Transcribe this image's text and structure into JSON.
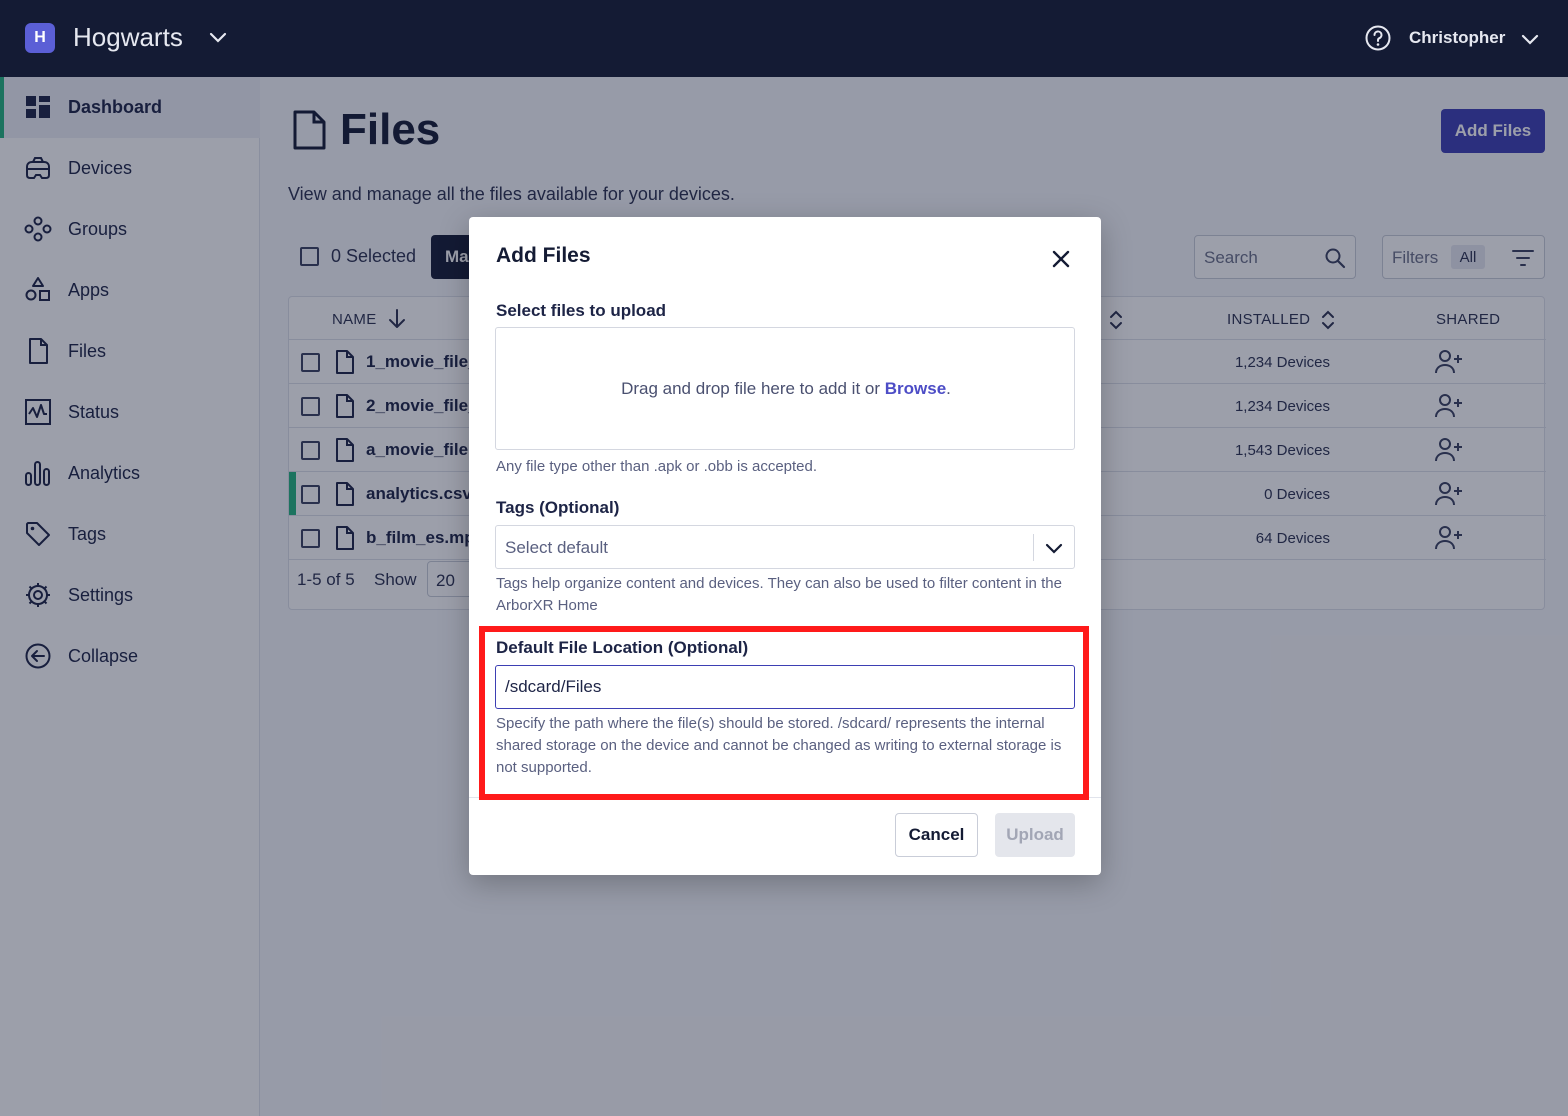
{
  "topbar": {
    "org_initial": "H",
    "org_name": "Hogwarts",
    "user_name": "Christopher"
  },
  "sidebar": {
    "items": [
      {
        "label": "Dashboard",
        "icon": "dashboard-icon",
        "active": true
      },
      {
        "label": "Devices",
        "icon": "headset-icon"
      },
      {
        "label": "Groups",
        "icon": "groups-icon"
      },
      {
        "label": "Apps",
        "icon": "apps-icon"
      },
      {
        "label": "Files",
        "icon": "file-icon"
      },
      {
        "label": "Status",
        "icon": "status-icon"
      },
      {
        "label": "Analytics",
        "icon": "analytics-icon"
      },
      {
        "label": "Tags",
        "icon": "tag-icon"
      },
      {
        "label": "Settings",
        "icon": "gear-icon"
      },
      {
        "label": "Collapse",
        "icon": "collapse-icon"
      }
    ]
  },
  "page": {
    "title": "Files",
    "add_button": "Add Files",
    "description": "View and manage all the files available for your devices."
  },
  "toolbar": {
    "selected_label": "0 Selected",
    "manage_label": "Ma",
    "search_placeholder": "Search",
    "filters_label": "Filters",
    "filters_badge": "All"
  },
  "table": {
    "columns": {
      "name": "NAME",
      "installed": "INSTALLED",
      "shared": "SHARED"
    },
    "rows": [
      {
        "name": "1_movie_file_",
        "installed": "1,234 Devices"
      },
      {
        "name": "2_movie_file_",
        "installed": "1,234 Devices"
      },
      {
        "name": "a_movie_file.",
        "installed": "1,543 Devices"
      },
      {
        "name": "analytics.csv",
        "installed": "0 Devices",
        "highlight": true
      },
      {
        "name": "b_film_es.mp",
        "installed": "64 Devices"
      }
    ],
    "pager_range": "1-5 of 5",
    "pager_show": "Show",
    "pager_size": "20"
  },
  "modal": {
    "title": "Add Files",
    "upload_section_label": "Select files to upload",
    "drop_text": "Drag and drop file here to add it or ",
    "drop_link": "Browse",
    "drop_end": ".",
    "drop_help": "Any file type other than .apk or .obb is accepted.",
    "tags_label": "Tags (Optional)",
    "tags_placeholder": "Select default",
    "tags_help": "Tags help organize content and devices. They can also be used to filter content in the ArborXR Home",
    "location_label": "Default File Location (Optional)",
    "location_value": "/sdcard/Files",
    "location_help": "Specify the path where the file(s) should be stored. /sdcard/ represents the internal shared storage on the device and cannot be changed as writing to external storage is not supported.",
    "cancel_label": "Cancel",
    "upload_label": "Upload"
  },
  "colors": {
    "topbar": "#141b34",
    "accent": "#3d3fb3",
    "active_indicator": "#24b47e",
    "highlight_box": "#ff1a1a"
  }
}
